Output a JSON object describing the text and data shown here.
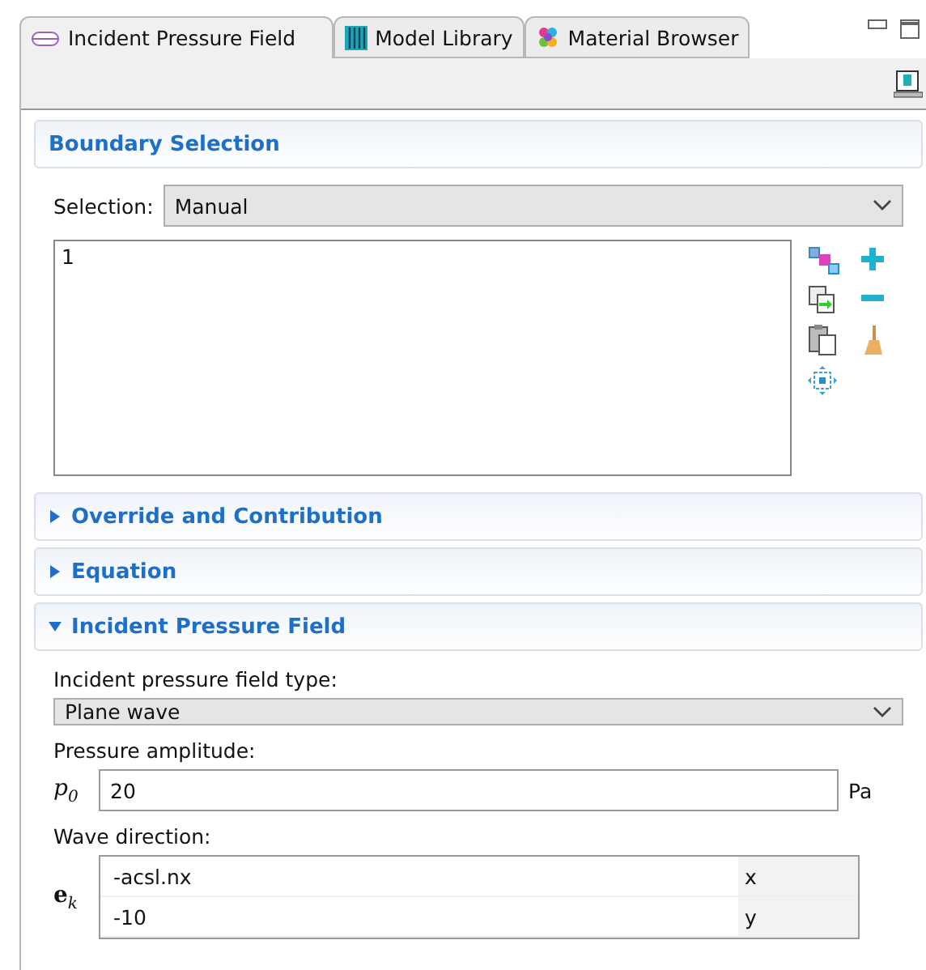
{
  "tabs": [
    {
      "label": "Incident Pressure Field",
      "kind": "boundary",
      "selected": true
    },
    {
      "label": "Model Library",
      "kind": "library",
      "selected": false
    },
    {
      "label": "Material Browser",
      "kind": "material",
      "selected": false
    }
  ],
  "sections": [
    {
      "title": "Boundary Selection",
      "kind": "plain"
    },
    {
      "title": "Override and Contribution",
      "kind": "collapsible",
      "expanded": false
    },
    {
      "title": "Equation",
      "kind": "collapsible",
      "expanded": false
    },
    {
      "title": "Incident Pressure Field",
      "kind": "collapsible",
      "expanded": true
    }
  ],
  "boundary_selection": {
    "label": "Selection:",
    "value": "Manual",
    "items": [
      "1"
    ]
  },
  "incident_field": {
    "type_label": "Incident pressure field type:",
    "type_value": "Plane wave",
    "amplitude_label": "Pressure amplitude:",
    "amplitude_symbol": "*p*$_{0}$",
    "amplitude_value": "20",
    "amplitude_unit": "Pa",
    "direction_label": "Wave direction:",
    "direction_symbol": "**e**$_{k}$",
    "direction_rows": [
      {
        "value": "-acsl.nx",
        "component": "x"
      },
      {
        "value": "-10",
        "component": "y"
      }
    ]
  }
}
